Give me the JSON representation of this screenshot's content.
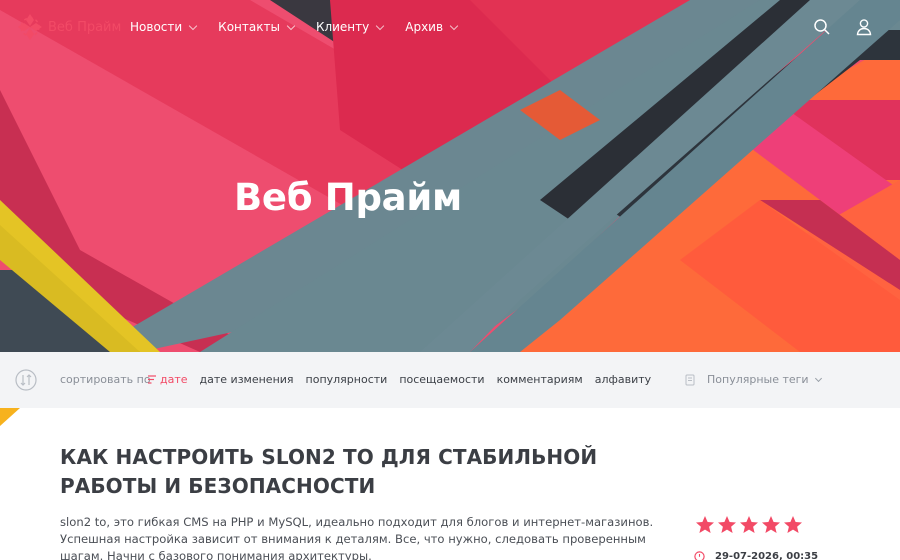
{
  "site": {
    "name": "Веб Прайм",
    "brand_color": "#f24a66"
  },
  "nav": {
    "items": [
      {
        "label": "Новости"
      },
      {
        "label": "Контакты"
      },
      {
        "label": "Клиенту"
      },
      {
        "label": "Архив"
      }
    ],
    "icons": [
      "search-icon",
      "user-icon"
    ]
  },
  "hero": {
    "title": "Веб Прайм"
  },
  "sortbar": {
    "label": "сортировать по",
    "options": [
      {
        "label": "дате",
        "active": true
      },
      {
        "label": "дате изменения",
        "active": false
      },
      {
        "label": "популярности",
        "active": false
      },
      {
        "label": "посещаемости",
        "active": false
      },
      {
        "label": "комментариям",
        "active": false
      },
      {
        "label": "алфавиту",
        "active": false
      }
    ],
    "tags_label": "Популярные теги"
  },
  "article": {
    "title": "Как настроить slon2 to для стабильной работы и безопасности",
    "text": "slon2 to, это гибкая CMS на PHP и MySQL, идеально подходит для блогов и интернет-магазинов. Успешная настройка зависит от внимания к деталям. Все, что нужно, следовать проверенным шагам. Начни с базового понимания архитектуры.",
    "rating": 5,
    "rating_max": 5,
    "date": "29-07-2026, 00:35"
  },
  "colors": {
    "star": "#f24a66",
    "sortbar_bg": "#f3f4f6",
    "title_text": "#3b3e44"
  }
}
